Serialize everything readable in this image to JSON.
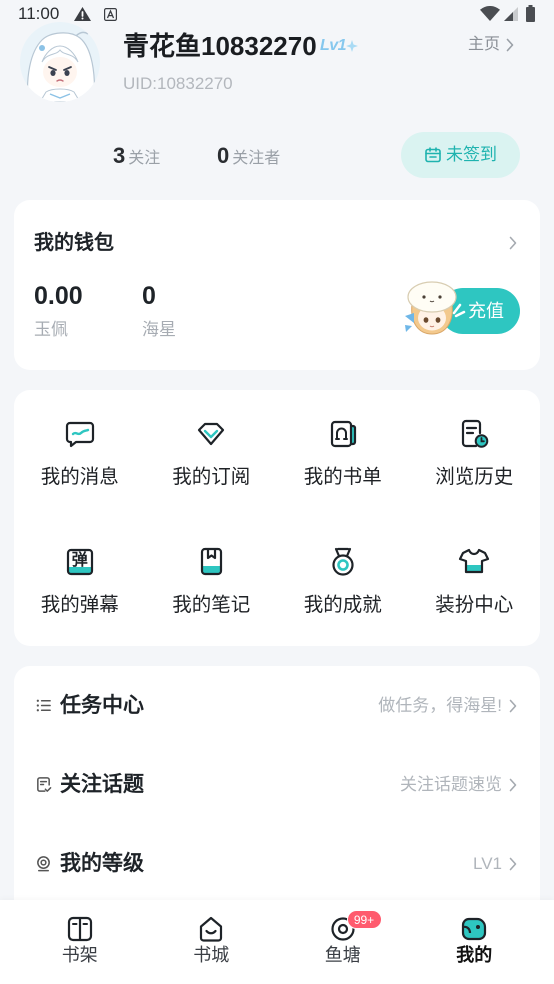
{
  "status_bar": {
    "time": "11:00",
    "icons": [
      "warning-icon",
      "font-a-icon",
      "wifi-icon",
      "signal-icon",
      "battery-icon"
    ]
  },
  "profile": {
    "name": "青花鱼10832270",
    "level_badge": "Lv1",
    "uid": "UID:10832270",
    "homepage_link": "主页"
  },
  "stats": [
    {
      "count": "3",
      "label": "关注"
    },
    {
      "count": "0",
      "label": "关注者"
    }
  ],
  "checkin_button": {
    "icon": "calendar-icon",
    "label": "未签到"
  },
  "wallet": {
    "title": "我的钱包",
    "balances": [
      {
        "value": "0.00",
        "label": "玉佩"
      },
      {
        "value": "0",
        "label": "海星"
      }
    ],
    "recharge_label": "充值"
  },
  "shortcuts": [
    {
      "label": "我的消息",
      "icon": "message-icon"
    },
    {
      "label": "我的订阅",
      "icon": "subscription-icon"
    },
    {
      "label": "我的书单",
      "icon": "booklist-icon"
    },
    {
      "label": "浏览历史",
      "icon": "history-icon"
    },
    {
      "label": "我的弹幕",
      "icon": "danmaku-icon",
      "icon_glyph": "弹"
    },
    {
      "label": "我的笔记",
      "icon": "notes-icon"
    },
    {
      "label": "我的成就",
      "icon": "achievement-icon"
    },
    {
      "label": "装扮中心",
      "icon": "dress-up-icon"
    }
  ],
  "menu": [
    {
      "label": "任务中心",
      "hint": "做任务，得海星!",
      "icon": "task-list-icon"
    },
    {
      "label": "关注话题",
      "hint": "关注话题速览",
      "icon": "topic-icon"
    },
    {
      "label": "我的等级",
      "hint": "LV1",
      "icon": "level-icon"
    }
  ],
  "tabbar": [
    {
      "label": "书架",
      "icon": "bookshelf-icon",
      "active": false
    },
    {
      "label": "书城",
      "icon": "bookstore-icon",
      "active": false
    },
    {
      "label": "鱼塘",
      "icon": "fishpond-icon",
      "badge": "99+",
      "active": false
    },
    {
      "label": "我的",
      "icon": "profile-icon",
      "active": true
    }
  ],
  "colors": {
    "bg": "#f4f6f9",
    "accent": "#2ec6c1",
    "accent-soft": "#daf3f1",
    "accent-text": "#1fb3af",
    "badge": "#ff5b6e",
    "text": "#1e2328",
    "muted": "#a7acb3"
  }
}
